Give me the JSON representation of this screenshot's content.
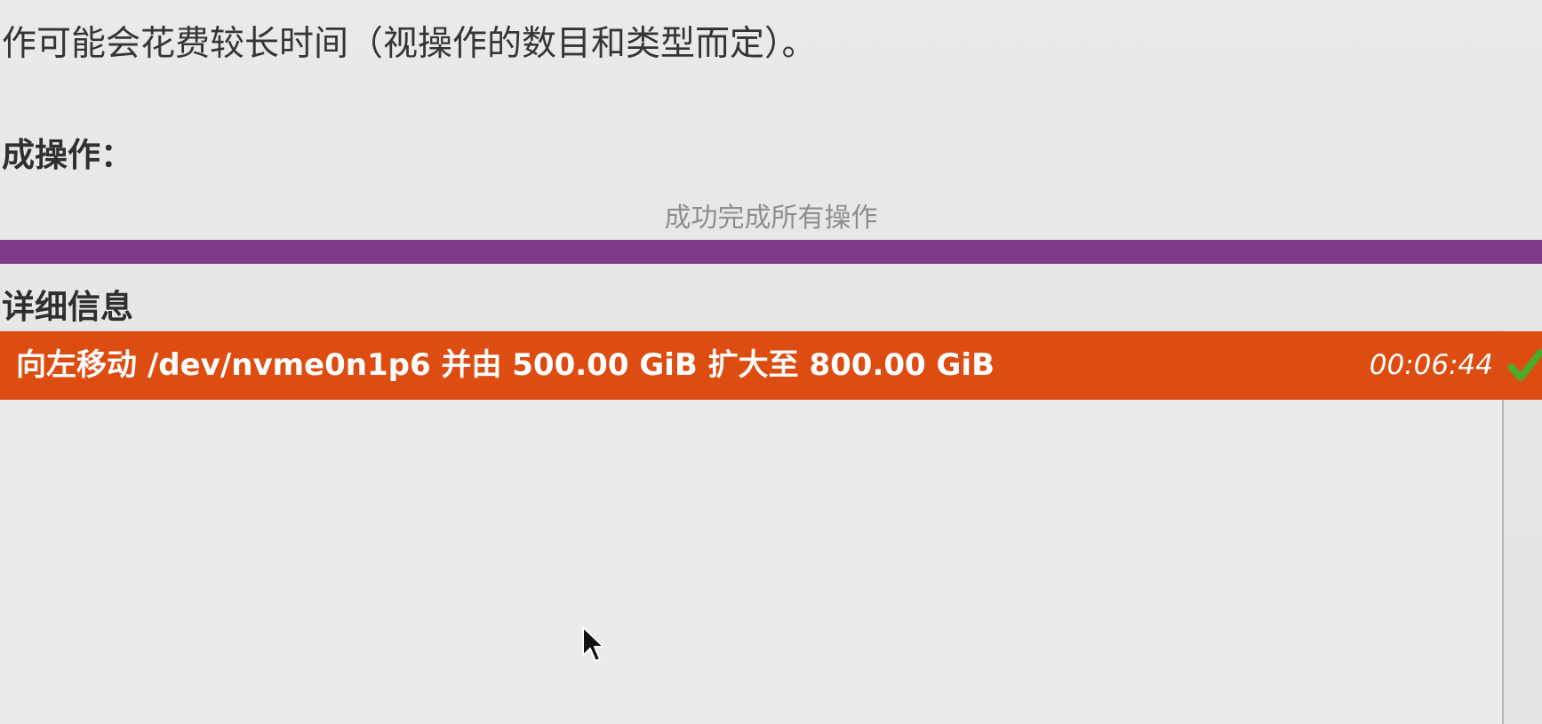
{
  "dialog": {
    "warning_text": "作可能会花费较长时间（视操作的数目和类型而定）。",
    "section_heading": "成操作：",
    "status_text": "成功完成所有操作",
    "progress": 1.0,
    "details_heading": "详细信息",
    "operations": [
      {
        "description": "向左移动 /dev/nvme0n1p6 并由 500.00 GiB 扩大至 800.00 GiB",
        "elapsed": "00:06:44",
        "status_icon": "check-icon"
      }
    ]
  },
  "colors": {
    "progress_fill": "#7e3a86",
    "selected_row": "#dd4d11",
    "check_green": "#4caa2b",
    "background": "#e7e8e8"
  }
}
